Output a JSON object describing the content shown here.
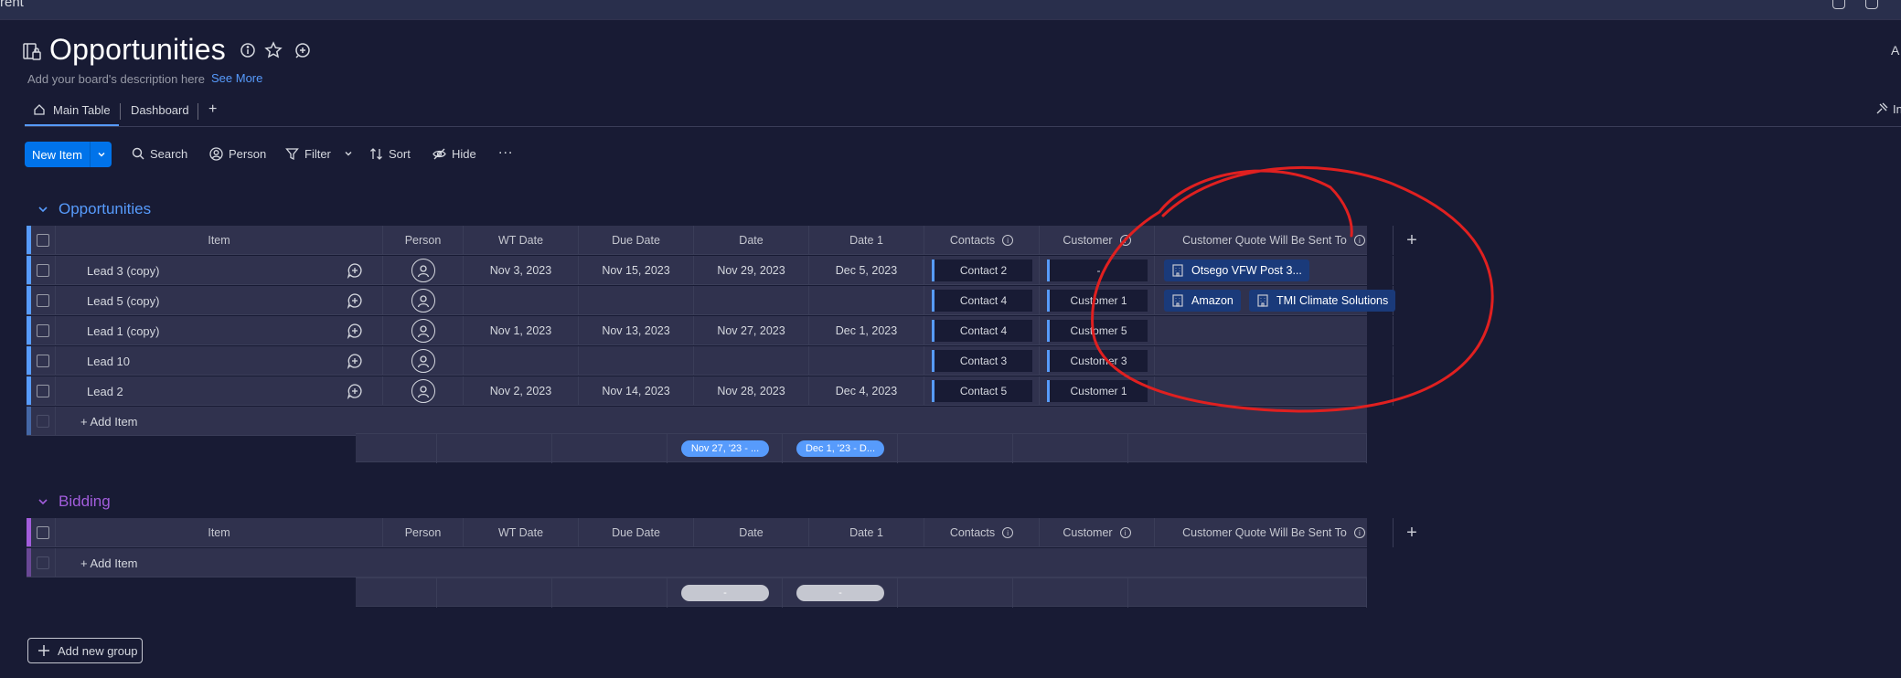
{
  "topbar": {
    "partial_label": "rent"
  },
  "header": {
    "title": "Opportunities",
    "description": "Add your board's description here",
    "see_more": "See More",
    "right_partial": "A"
  },
  "tabs": [
    {
      "label": "Main Table",
      "active": true
    },
    {
      "label": "Dashboard",
      "active": false
    }
  ],
  "tabs_add": "+",
  "right_tab_partial": "In",
  "toolbar": {
    "new_item": "New Item",
    "search": "Search",
    "person": "Person",
    "filter": "Filter",
    "sort": "Sort",
    "hide": "Hide",
    "more": "..."
  },
  "columns": [
    "Item",
    "Person",
    "WT Date",
    "Due Date",
    "Date",
    "Date 1",
    "Contacts",
    "Customer",
    "Customer Quote Will Be Sent To"
  ],
  "groups": [
    {
      "title": "Opportunities",
      "color": "#579bfc",
      "rows": [
        {
          "item": "Lead 3 (copy)",
          "wt_date": "Nov 3, 2023",
          "due_date": "Nov 15, 2023",
          "date": "Nov 29, 2023",
          "date1": "Dec 5, 2023",
          "contact": "Contact 2",
          "customer": "-",
          "quotes": [
            "Otsego VFW Post 3..."
          ]
        },
        {
          "item": "Lead 5 (copy)",
          "wt_date": "",
          "due_date": "",
          "date": "",
          "date1": "",
          "contact": "Contact 4",
          "customer": "Customer 1",
          "quotes": [
            "Amazon",
            "TMI Climate Solutions"
          ]
        },
        {
          "item": "Lead 1 (copy)",
          "wt_date": "Nov 1, 2023",
          "due_date": "Nov 13, 2023",
          "date": "Nov 27, 2023",
          "date1": "Dec 1, 2023",
          "contact": "Contact 4",
          "customer": "Customer 5",
          "quotes": []
        },
        {
          "item": "Lead 10",
          "wt_date": "",
          "due_date": "",
          "date": "",
          "date1": "",
          "contact": "Contact 3",
          "customer": "Customer 3",
          "quotes": []
        },
        {
          "item": "Lead 2",
          "wt_date": "Nov 2, 2023",
          "due_date": "Nov 14, 2023",
          "date": "Nov 28, 2023",
          "date1": "Dec 4, 2023",
          "contact": "Contact 5",
          "customer": "Customer 1",
          "quotes": []
        }
      ],
      "add_item": "+ Add Item",
      "summary": {
        "date": "Nov 27, '23 - ...",
        "date1": "Dec 1, '23 - D..."
      }
    },
    {
      "title": "Bidding",
      "color": "#a25ddc",
      "rows": [],
      "add_item": "+ Add Item",
      "summary": {
        "date": "-",
        "date1": "-"
      }
    }
  ],
  "add_group": "Add new group",
  "colors": {
    "background": "#181b34",
    "row": "#30324e",
    "primary": "#0073ea",
    "annotation": "#e02020"
  }
}
